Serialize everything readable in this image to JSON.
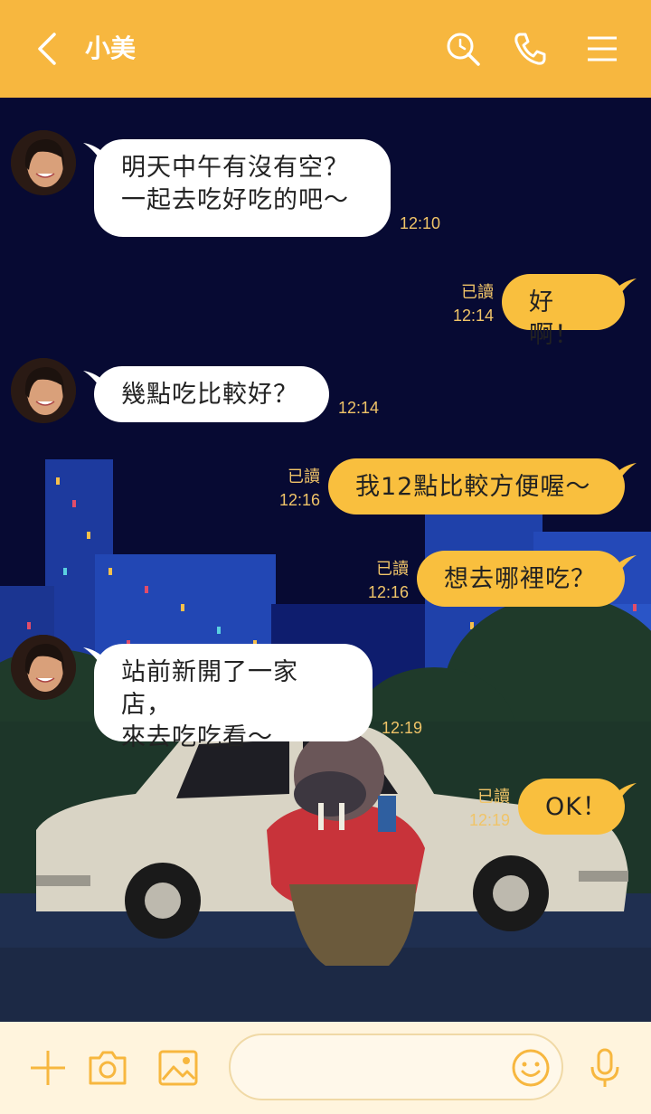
{
  "header": {
    "title": "小美",
    "back_icon": "chevron-left-icon",
    "search_icon": "search-icon",
    "call_icon": "phone-icon",
    "menu_icon": "menu-icon",
    "color": "#f7b73f"
  },
  "messages": [
    {
      "side": "in",
      "lines": [
        "明天中午有沒有空？",
        "一起去吃好吃的吧～"
      ],
      "time": "12:10"
    },
    {
      "side": "out",
      "text": "好啊！",
      "read": "已讀",
      "time": "12:14"
    },
    {
      "side": "in",
      "lines": [
        "幾點吃比較好？"
      ],
      "time": "12:14"
    },
    {
      "side": "out",
      "text": "我12點比較方便喔～",
      "read": "已讀",
      "time": "12:16"
    },
    {
      "side": "out",
      "text": "想去哪裡吃？",
      "read": "已讀",
      "time": "12:16"
    },
    {
      "side": "in",
      "lines": [
        "站前新開了一家店，",
        "來去吃吃看～"
      ],
      "time": "12:19"
    },
    {
      "side": "out",
      "text": "OK！",
      "read": "已讀",
      "time": "12:19"
    }
  ],
  "bottom_bar": {
    "add_icon": "plus-icon",
    "camera_icon": "camera-icon",
    "image_icon": "image-icon",
    "emoji_icon": "emoji-icon",
    "mic_icon": "microphone-icon",
    "input_value": "",
    "accent": "#f7b73f"
  },
  "background": {
    "description_icons": [
      "city-night-skyline",
      "walrus-character",
      "white-car"
    ],
    "sky_color": "#070a33"
  }
}
